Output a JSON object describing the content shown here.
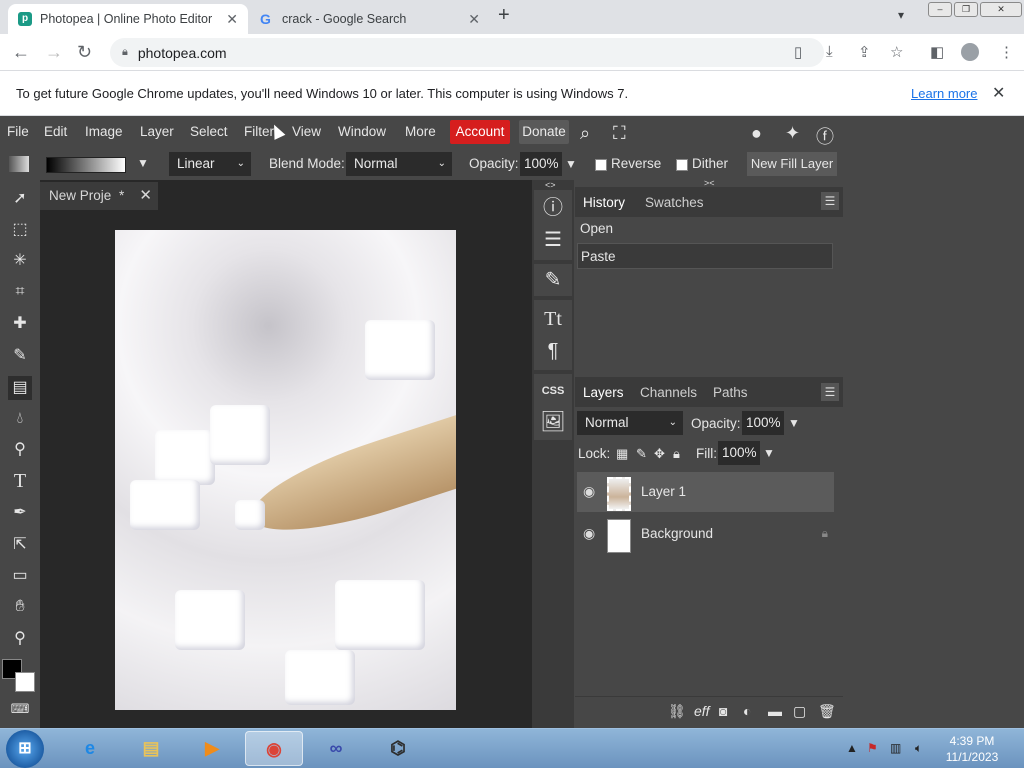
{
  "browser": {
    "tabs": [
      {
        "title": "Photopea | Online Photo Editor",
        "active": true
      },
      {
        "title": "crack - Google Search",
        "active": false
      }
    ],
    "url": "photopea.com",
    "infobar_text": "To get future Google Chrome updates, you'll need Windows 10 or later. This computer is using Windows 7.",
    "infobar_link": "Learn more"
  },
  "menu": {
    "items": [
      "File",
      "Edit",
      "Image",
      "Layer",
      "Select",
      "Filter",
      "View",
      "Window",
      "More"
    ],
    "account": "Account",
    "donate": "Donate"
  },
  "options": {
    "gradient_type": "Linear",
    "blend_mode_label": "Blend Mode:",
    "blend_mode": "Normal",
    "opacity_label": "Opacity:",
    "opacity": "100%",
    "reverse": "Reverse",
    "dither": "Dither",
    "new_fill_layer": "New Fill Layer"
  },
  "document": {
    "tab_title": "New Proje",
    "modified_marker": "*"
  },
  "history_panel": {
    "tabs": [
      "History",
      "Swatches"
    ],
    "items": [
      "Open",
      "Paste"
    ]
  },
  "layers_panel": {
    "tabs": [
      "Layers",
      "Channels",
      "Paths"
    ],
    "blend_mode": "Normal",
    "opacity_label": "Opacity:",
    "opacity": "100%",
    "lock_label": "Lock:",
    "fill_label": "Fill:",
    "fill": "100%",
    "layers": [
      {
        "name": "Layer 1",
        "selected": true
      },
      {
        "name": "Background",
        "selected": false
      }
    ],
    "bottom_eff": "eff"
  },
  "taskbar": {
    "time": "4:39 PM",
    "date": "11/1/2023"
  }
}
